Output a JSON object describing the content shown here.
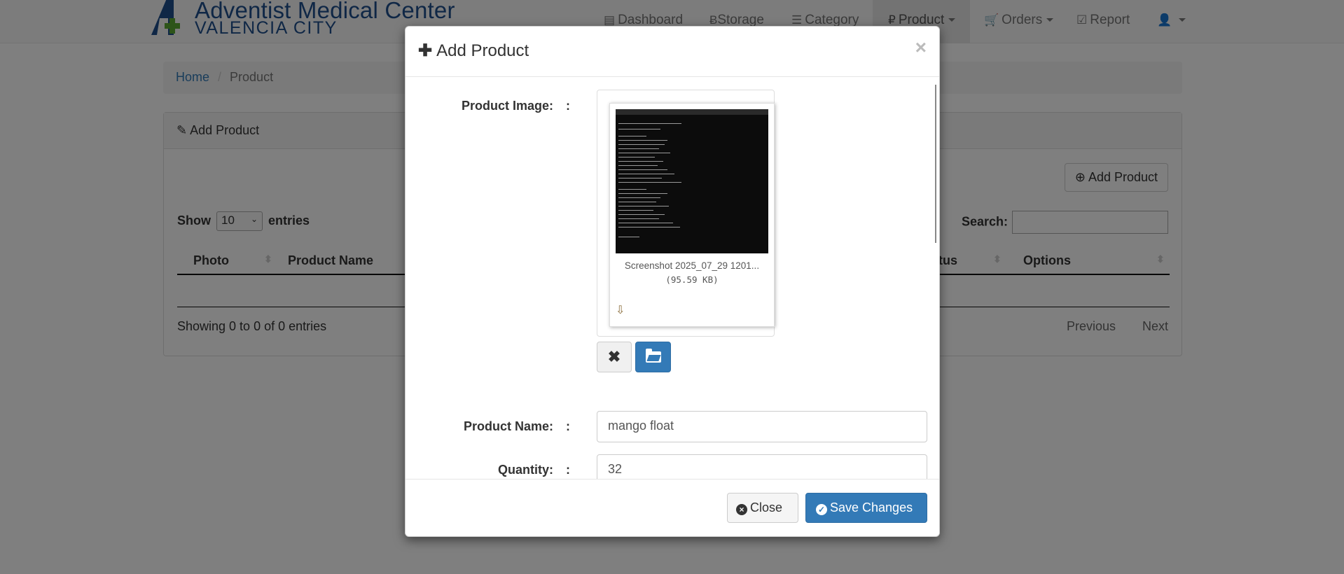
{
  "brand": {
    "name": "Adventist Medical Center",
    "city": "VALENCIA CITY"
  },
  "nav": [
    {
      "label": "Dashboard",
      "icon": "dashboard-icon"
    },
    {
      "label": "Storage",
      "icon": "bitcoin-icon"
    },
    {
      "label": "Category",
      "icon": "list-icon"
    },
    {
      "label": "Product",
      "icon": "ruble-icon",
      "active": true
    },
    {
      "label": "Orders",
      "icon": "cart-icon"
    },
    {
      "label": "Report",
      "icon": "check-square-icon"
    },
    {
      "label": "",
      "icon": "user-icon"
    }
  ],
  "breadcrumb": {
    "home": "Home",
    "current": "Product"
  },
  "panel": {
    "heading": "Add Product",
    "add_button": "Add Product",
    "show_label": "Show",
    "entries_value": "10",
    "entries_label": "entries",
    "search_label": "Search:",
    "columns": [
      "Photo",
      "Product Name",
      "Status",
      "Options"
    ],
    "info": "Showing 0 to 0 of 0 entries",
    "prev": "Previous",
    "next": "Next"
  },
  "modal": {
    "title": "Add Product",
    "close_symbol": "×",
    "labels": {
      "image": "Product Image:",
      "name": "Product Name:",
      "quantity": "Quantity:",
      "colon": ":"
    },
    "file": {
      "caption": "Screenshot 2025_07_29 1201...",
      "size": "(95.59 KB)"
    },
    "fields": {
      "product_name": "mango float",
      "quantity": "32"
    },
    "footer": {
      "close": "Close",
      "save": "Save Changes"
    }
  },
  "colors": {
    "primary": "#337ab7",
    "brand": "#1f4e8c",
    "backdrop": "rgba(0,0,0,0.5)"
  }
}
